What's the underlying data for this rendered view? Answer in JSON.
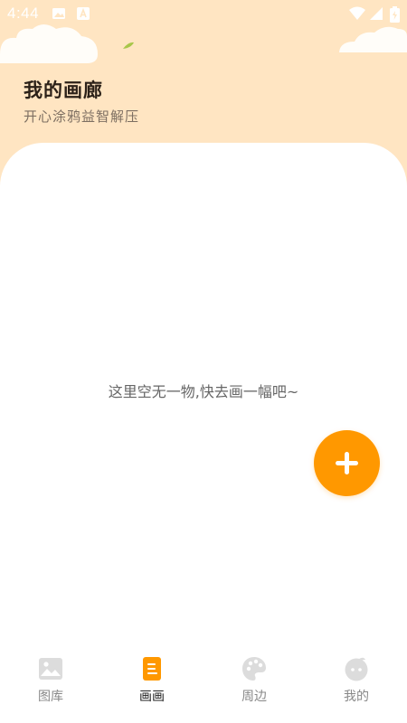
{
  "status_bar": {
    "time": "4:44"
  },
  "header": {
    "title": "我的画廊",
    "subtitle": "开心涂鸦益智解压"
  },
  "main": {
    "empty_message": "这里空无一物,快去画一幅吧~"
  },
  "tabbar": {
    "items": [
      {
        "label": "图库",
        "icon": "gallery-icon",
        "active": false
      },
      {
        "label": "画画",
        "icon": "draw-icon",
        "active": true
      },
      {
        "label": "周边",
        "icon": "palette-icon",
        "active": false
      },
      {
        "label": "我的",
        "icon": "profile-icon",
        "active": false
      }
    ]
  },
  "colors": {
    "header_bg": "#ffe5c2",
    "accent": "#ff9800",
    "inactive_icon": "#dcdcdc",
    "status_icon": "#ffffff"
  }
}
